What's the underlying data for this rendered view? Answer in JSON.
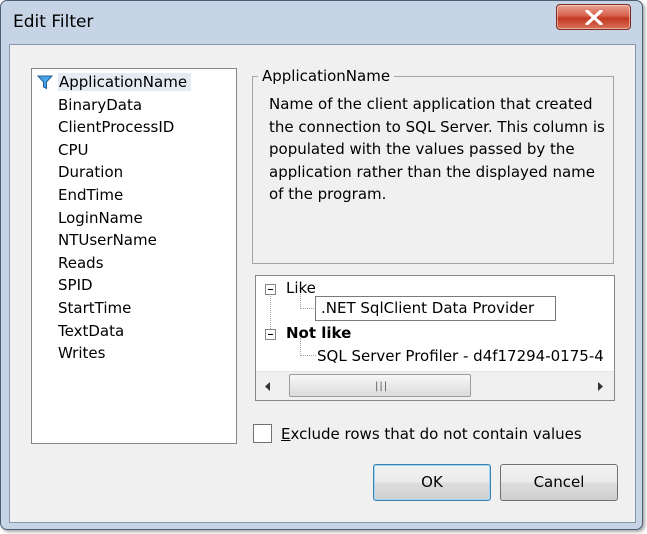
{
  "window": {
    "title": "Edit Filter"
  },
  "fields": [
    "ApplicationName",
    "BinaryData",
    "ClientProcessID",
    "CPU",
    "Duration",
    "EndTime",
    "LoginName",
    "NTUserName",
    "Reads",
    "SPID",
    "StartTime",
    "TextData",
    "Writes"
  ],
  "selected_field": "ApplicationName",
  "description": {
    "heading": "ApplicationName",
    "text": "Name of the client application that created the connection to SQL Server. This column is populated with the values passed by the application rather than the displayed name of the program."
  },
  "tree": {
    "like_label": "Like",
    "like_value": ".NET SqlClient Data Provider",
    "not_like_label": "Not like",
    "not_like_value": "SQL Server Profiler - d4f17294-0175-4",
    "scroll_grip": "|||"
  },
  "exclude": {
    "mnemonic": "E",
    "rest": "xclude rows that do not contain values",
    "checked": false
  },
  "buttons": {
    "ok": "OK",
    "cancel": "Cancel"
  },
  "colors": {
    "close_button": "#c8452d",
    "selection": "#e5ebf3",
    "frame": "#c6d4e6"
  }
}
